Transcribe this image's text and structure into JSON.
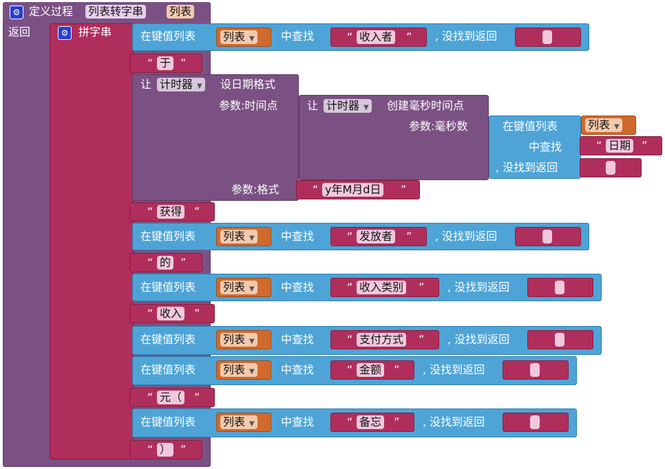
{
  "procedure": {
    "header": "定义过程",
    "name": "列表转字串",
    "param": "列表",
    "return_label": "返回",
    "gear": "gear-icon"
  },
  "join": {
    "label": "拼字串"
  },
  "lookup": {
    "label": "在键值列表",
    "find": "中查找",
    "not_found": ", 没找到返回",
    "not_found_line": ", 没找到返回",
    "var": "列表"
  },
  "rows": {
    "r1_key": "收入者",
    "t1": "于",
    "timer": {
      "let": "让",
      "component": "计时器",
      "set_format": "设日期格式",
      "param_time": "参数:时间点",
      "create": "创建毫秒时间点",
      "param_ms": "参数:毫秒数",
      "date_key": "日期",
      "param_format": "参数:格式",
      "format": "y年M月d日"
    },
    "t2": "获得",
    "r3_key": "发放者",
    "t3": "的",
    "r4_key": "收入类别",
    "t4": "收入",
    "r5_key": "支付方式",
    "r6_key": "金额",
    "t6": "元（",
    "r7_key": "备忘",
    "t7": "）"
  },
  "colors": {
    "procedure": "#7b5183",
    "join": "#b02e5c",
    "lookup": "#4ea4d7",
    "variable": "#cf6a2c"
  }
}
